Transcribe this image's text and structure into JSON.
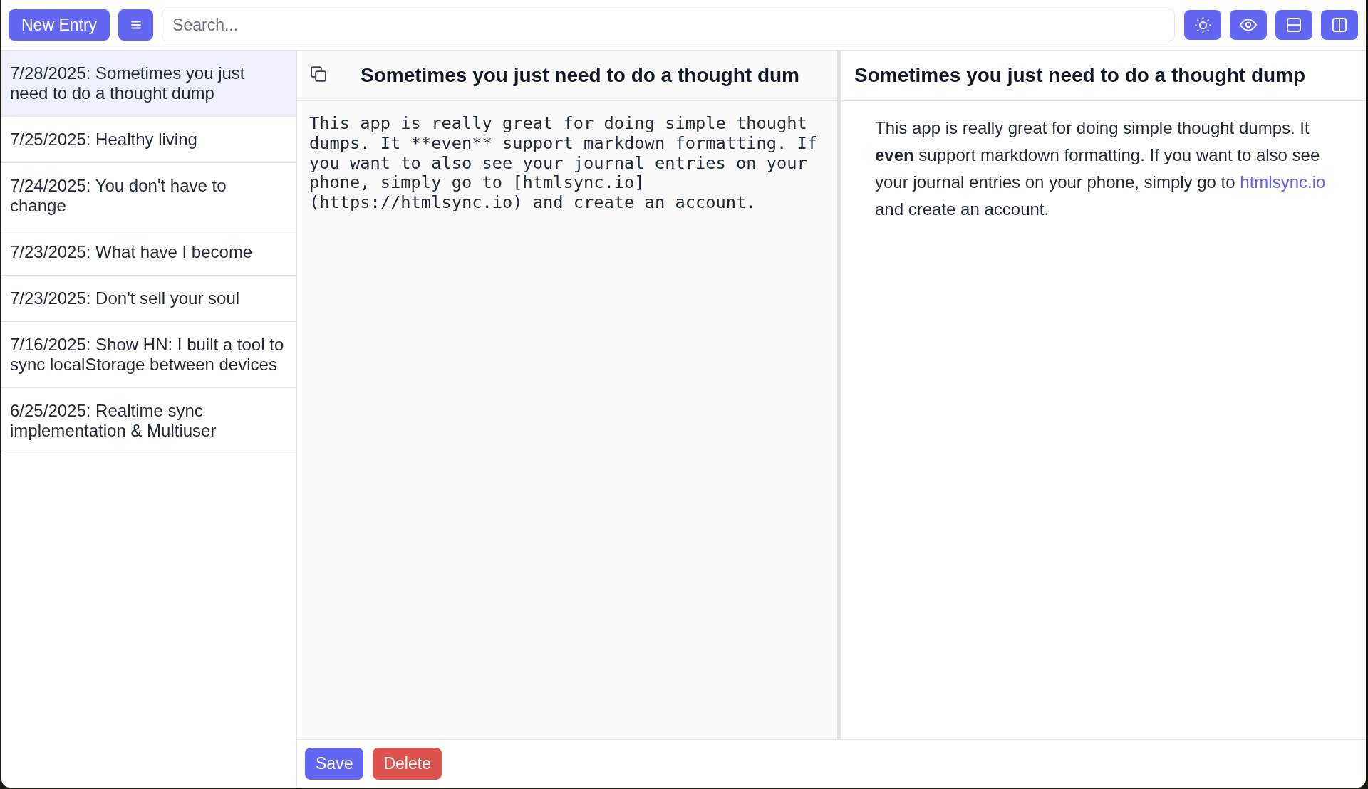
{
  "toolbar": {
    "new_entry_button": "New Entry",
    "search": {
      "placeholder": "Search..."
    }
  },
  "sidebar": {
    "entries": [
      {
        "label": "7/28/2025: Sometimes you just need to do a thought dump",
        "selected": true
      },
      {
        "label": "7/25/2025: Healthy living",
        "selected": false
      },
      {
        "label": "7/24/2025: You don't have to change",
        "selected": false
      },
      {
        "label": "7/23/2025: What have I become",
        "selected": false
      },
      {
        "label": "7/23/2025: Don't sell your soul",
        "selected": false
      },
      {
        "label": "7/16/2025: Show HN: I built a tool to sync localStorage between devices",
        "selected": false
      },
      {
        "label": "6/25/2025: Realtime sync implementation & Multiuser",
        "selected": false
      }
    ]
  },
  "editor": {
    "title": "Sometimes you just need to do a thought dum",
    "body": "This app is really great for doing simple thought dumps. It **even** support markdown formatting. If you want to also see your journal entries on your phone, simply go to [htmlsync.io](https://htmlsync.io) and create an account."
  },
  "preview": {
    "title": "Sometimes you just need to do a thought dump",
    "paragraph": {
      "before": "This app is really great for doing simple thought dumps. It **even** support markdown formatting. If you want to also see your journal entries on your phone, simply go to",
      "link": "htmlsync.io",
      "after": "and create an account."
    }
  },
  "actions": [
    {
      "label": "Save",
      "kind": "primary"
    },
    {
      "label": "Delete",
      "kind": "danger"
    }
  ]
}
